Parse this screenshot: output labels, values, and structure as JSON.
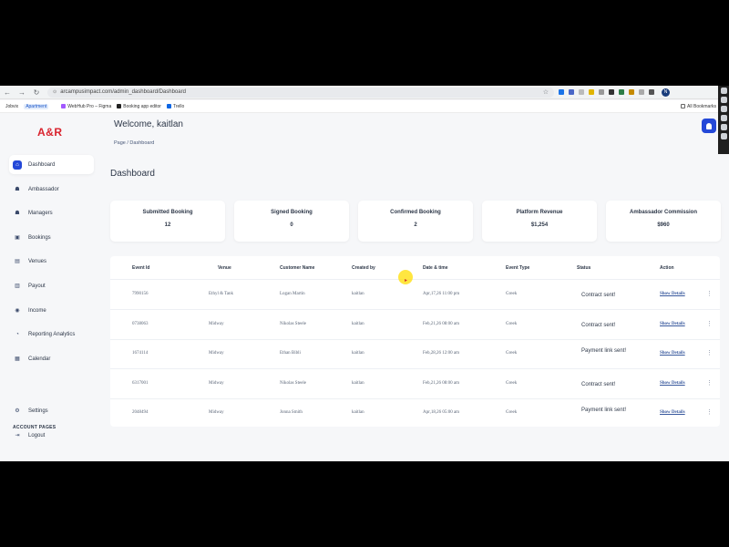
{
  "browser": {
    "url": "arcampusimpact.com/admin_dashboard/Dashboard",
    "profile_initial": "N",
    "bookmarks": [
      "Jobvix",
      "Apartment",
      "WebHub Pro – Figma",
      "Booking app editor",
      "Trello"
    ],
    "all_bookmarks": "All Bookmarks"
  },
  "sidebar": {
    "logo": "A&R",
    "items": [
      {
        "label": "Dashboard",
        "icon": "home-icon",
        "active": true
      },
      {
        "label": "Ambassador",
        "icon": "users-icon"
      },
      {
        "label": "Managers",
        "icon": "users-icon"
      },
      {
        "label": "Bookings",
        "icon": "calendar-check-icon"
      },
      {
        "label": "Venues",
        "icon": "building-icon"
      },
      {
        "label": "Payout",
        "icon": "wallet-icon"
      },
      {
        "label": "Income",
        "icon": "money-icon"
      },
      {
        "label": "Reporting Analytics",
        "icon": "chart-icon"
      },
      {
        "label": "Calendar",
        "icon": "calendar-icon"
      }
    ],
    "account_title": "ACCOUNT PAGES",
    "account_items": [
      {
        "label": "Settings",
        "icon": "gear-icon"
      },
      {
        "label": "Logout",
        "icon": "logout-icon"
      }
    ]
  },
  "header": {
    "welcome": "Welcome, kaitlan",
    "breadcrumb": "Page / Dashboard",
    "title": "Dashboard"
  },
  "stats": [
    {
      "label": "Submitted Booking",
      "value": "12"
    },
    {
      "label": "Signed Booking",
      "value": "0"
    },
    {
      "label": "Confirmed Booking",
      "value": "2"
    },
    {
      "label": "Platform Revenue",
      "value": "$1,254"
    },
    {
      "label": "Ambassador Commission",
      "value": "$960"
    }
  ],
  "table": {
    "columns": [
      "Event Id",
      "Venue",
      "Customer Name",
      "Created by",
      "Date & time",
      "Event Type",
      "Status",
      "Action"
    ],
    "rows": [
      {
        "id": "7990156",
        "venue": "Ethyl & Tank",
        "customer": "Logan Martin",
        "created_by": "kaitlan",
        "datetime": "Apr,17,26 11:00 pm",
        "type": "Greek",
        "status": "Contract sent!",
        "action": "Show Details"
      },
      {
        "id": "0738063",
        "venue": "Midway",
        "customer": "Nikolas Steele",
        "created_by": "kaitlan",
        "datetime": "Feb,21,26 08:00 am",
        "type": "Greek",
        "status": "Contract sent!",
        "action": "Show Details"
      },
      {
        "id": "1674114",
        "venue": "Midway",
        "customer": "Ethan Bibli",
        "created_by": "kaitlan",
        "datetime": "Feb,28,26 12:00 am",
        "type": "Greek",
        "status": "Payment link sent!",
        "action": "Show Details"
      },
      {
        "id": "6317001",
        "venue": "Midway",
        "customer": "Nikolas Steele",
        "created_by": "kaitlan",
        "datetime": "Feb,21,26 08:00 am",
        "type": "Greek",
        "status": "Contract sent!",
        "action": "Show Details"
      },
      {
        "id": "2048494",
        "venue": "Midway",
        "customer": "Jonna Smith",
        "created_by": "kaitlan",
        "datetime": "Apr,18,26 05:00 am",
        "type": "Greek",
        "status": "Payment link sent!",
        "action": "Show Details"
      }
    ]
  },
  "colors": {
    "brand": "#d9232e",
    "accent": "#2448d8",
    "link": "#3a5a9e"
  }
}
